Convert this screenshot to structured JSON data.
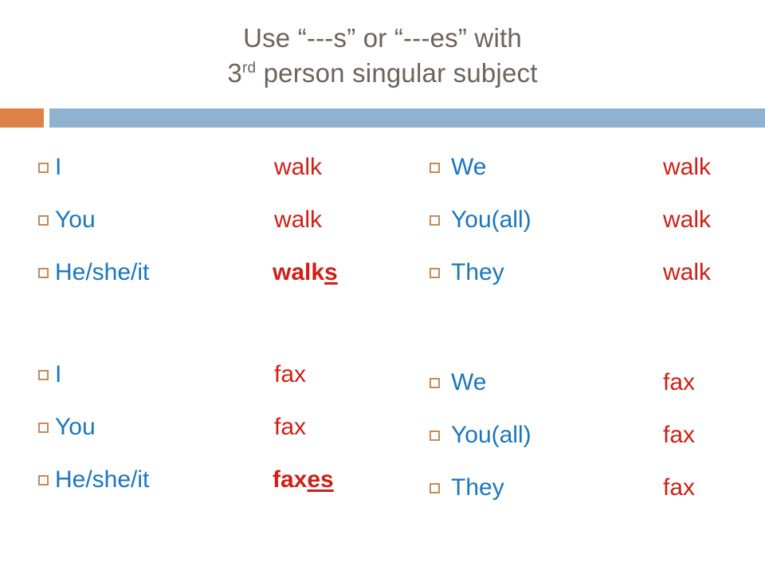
{
  "slide": {
    "title_line1": "Use “---s” or “---es” with",
    "title_line2_prefix": "3",
    "title_line2_ordinal": "rd",
    "title_line2_rest": " person singular subject",
    "bullet_icon": "hollow-square-bullet"
  },
  "colors": {
    "title": "#6d625c",
    "subject": "#1b76bc",
    "verb": "#cf2017",
    "bullet": "#c38b5a",
    "divider_accent": "#dd8247",
    "divider_bar": "#8fb2d1",
    "background": "#ffffff"
  },
  "blocks": {
    "walk_singular": {
      "rows": [
        {
          "subject": "I",
          "verb_stem": "walk",
          "verb_suffix": "",
          "emphasis": false
        },
        {
          "subject": "You",
          "verb_stem": "walk",
          "verb_suffix": "",
          "emphasis": false
        },
        {
          "subject": "He/she/it",
          "verb_stem": "walk",
          "verb_suffix": "s",
          "emphasis": true
        }
      ]
    },
    "walk_plural": {
      "rows": [
        {
          "subject": "We",
          "verb_stem": "walk",
          "verb_suffix": "",
          "emphasis": false
        },
        {
          "subject": "You(all)",
          "verb_stem": "walk",
          "verb_suffix": "",
          "emphasis": false
        },
        {
          "subject": "They",
          "verb_stem": "walk",
          "verb_suffix": "",
          "emphasis": false
        }
      ]
    },
    "fax_singular": {
      "rows": [
        {
          "subject": "I",
          "verb_stem": "fax",
          "verb_suffix": "",
          "emphasis": false
        },
        {
          "subject": "You",
          "verb_stem": "fax",
          "verb_suffix": "",
          "emphasis": false
        },
        {
          "subject": "He/she/it",
          "verb_stem": "fax",
          "verb_suffix": "es",
          "emphasis": true
        }
      ]
    },
    "fax_plural": {
      "rows": [
        {
          "subject": "We",
          "verb_stem": "fax",
          "verb_suffix": "",
          "emphasis": false
        },
        {
          "subject": "You(all)",
          "verb_stem": "fax",
          "verb_suffix": "",
          "emphasis": false
        },
        {
          "subject": "They",
          "verb_stem": "fax",
          "verb_suffix": "",
          "emphasis": false
        }
      ]
    }
  }
}
